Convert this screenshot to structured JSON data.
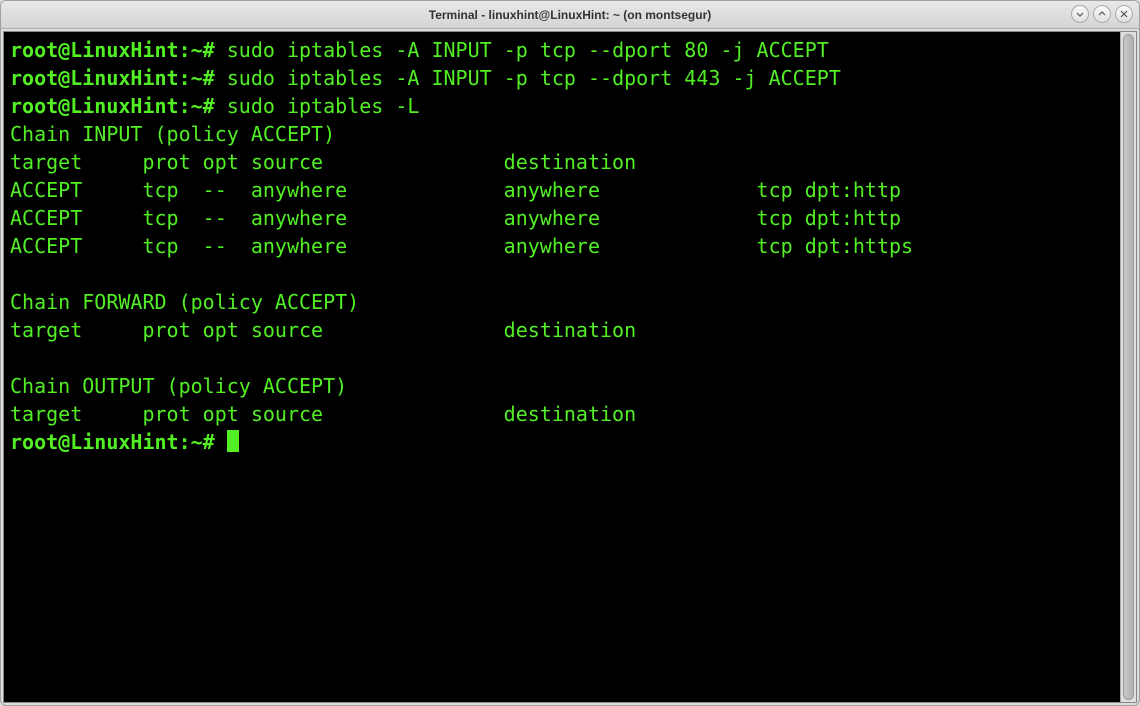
{
  "titlebar": {
    "title": "Terminal - linuxhint@LinuxHint: ~ (on montsegur)"
  },
  "window_controls": {
    "minimize": "minimize-icon",
    "maximize": "maximize-icon",
    "close": "close-icon"
  },
  "terminal": {
    "prompt": "root@LinuxHint:~# ",
    "lines": [
      {
        "prompt": "root@LinuxHint:~# ",
        "cmd": "sudo iptables -A INPUT -p tcp --dport 80 -j ACCEPT"
      },
      {
        "prompt": "root@LinuxHint:~# ",
        "cmd": "sudo iptables -A INPUT -p tcp --dport 443 -j ACCEPT"
      },
      {
        "prompt": "root@LinuxHint:~# ",
        "cmd": "sudo iptables -L"
      }
    ],
    "output": [
      "Chain INPUT (policy ACCEPT)",
      "target     prot opt source               destination         ",
      "ACCEPT     tcp  --  anywhere             anywhere             tcp dpt:http",
      "ACCEPT     tcp  --  anywhere             anywhere             tcp dpt:http",
      "ACCEPT     tcp  --  anywhere             anywhere             tcp dpt:https",
      "",
      "Chain FORWARD (policy ACCEPT)",
      "target     prot opt source               destination         ",
      "",
      "Chain OUTPUT (policy ACCEPT)",
      "target     prot opt source               destination         "
    ],
    "final_prompt": "root@LinuxHint:~# "
  }
}
